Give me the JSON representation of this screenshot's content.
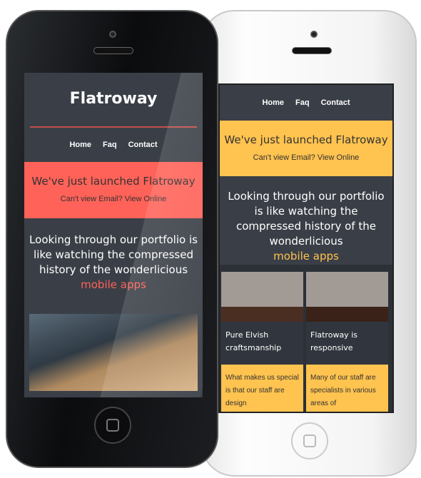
{
  "colors": {
    "accent_red": "#ff6258",
    "accent_yellow": "#ffc34f",
    "dark_bg": "#3a3f47"
  },
  "black_phone": {
    "logo": "Flatroway",
    "nav": [
      "Home",
      "Faq",
      "Contact"
    ],
    "banner": {
      "title": "We've just launched Flatroway",
      "link": "Can't view Email? View Online"
    },
    "hero": {
      "text": "Looking through our portfolio is like watching the compressed history of the wonderlicious",
      "highlight": "mobile apps"
    }
  },
  "white_phone": {
    "nav": [
      "Home",
      "Faq",
      "Contact"
    ],
    "banner": {
      "title": "We've just launched Flatroway",
      "link": "Can't view Email? View Online"
    },
    "hero": {
      "text": "Looking through our portfolio is like watching the compressed history of the wonderlicious",
      "highlight": "mobile apps"
    },
    "cards": [
      {
        "title": "Pure Elvish craftsmanship",
        "body": "What makes us special is that our staff are design"
      },
      {
        "title": "Flatroway is responsive",
        "body": "Many of our staff are specialists in various areas of"
      }
    ]
  }
}
